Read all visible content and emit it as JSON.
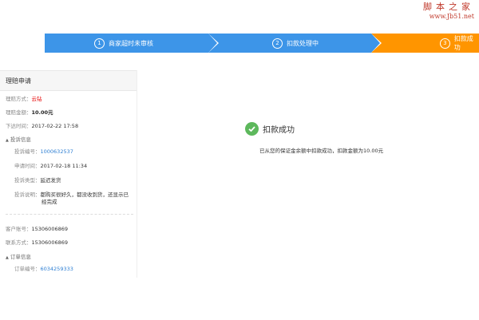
{
  "watermark": {
    "brand": "脚本之家",
    "url": "www.Jb51.net"
  },
  "steps": [
    {
      "num": "1",
      "label": "商家超时未审核"
    },
    {
      "num": "2",
      "label": "扣款处理中"
    },
    {
      "num": "3",
      "label": "扣款成功"
    }
  ],
  "sidebar": {
    "title": "理赔申请",
    "claim_method": {
      "label": "理赔方式：",
      "value": "云钻"
    },
    "claim_amount": {
      "label": "理赔金额：",
      "value": "10.00元"
    },
    "order_time": {
      "label": "下达时间：",
      "value": "2017-02-22 17:58"
    },
    "complaint_section": "投诉信息",
    "complaint_no": {
      "label": "投诉编号：",
      "value": "1000632537"
    },
    "apply_time": {
      "label": "申请时间：",
      "value": "2017-02-18 11:34"
    },
    "complaint_type": {
      "label": "投诉类型：",
      "value": "延迟发货"
    },
    "complaint_desc": {
      "label": "投诉说明：",
      "value_line1": "都购买很好久，都没收到货，还显示已",
      "value_line2": "经完成"
    },
    "customer_no": {
      "label": "客户账号：",
      "value": "15306006869"
    },
    "contact": {
      "label": "联系方式：",
      "value": "15306006869"
    },
    "order_section": "订单信息",
    "order_no": {
      "label": "订单编号：",
      "value": "6034259333"
    }
  },
  "result": {
    "title": "扣款成功",
    "description": "已从您的保证金余额中扣款成功，扣款金额为10.00元"
  },
  "colors": {
    "step_active": "#3d95e8",
    "step_current": "#ff9500",
    "success": "#5db85c",
    "link": "#2e7fd3",
    "highlight": "#e60000"
  }
}
